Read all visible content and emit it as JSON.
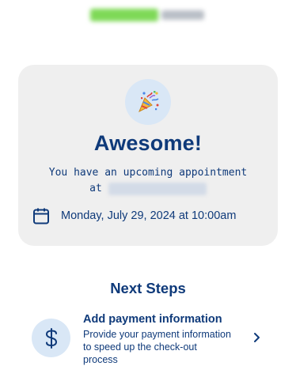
{
  "card": {
    "title": "Awesome!",
    "message_line1": "You have an upcoming appointment",
    "message_line2": "at",
    "appointment_datetime": "Monday, July 29, 2024 at 10:00am",
    "party_icon": "party-popper-icon",
    "calendar_icon": "calendar-icon"
  },
  "next_steps": {
    "title": "Next Steps",
    "items": [
      {
        "title": "Add payment information",
        "description": "Provide your payment information to speed up the check-out process",
        "icon": "dollar-icon",
        "action_icon": "chevron-right-icon"
      }
    ]
  },
  "colors": {
    "primary_text": "#0f3a7a",
    "card_bg": "#efefef",
    "icon_circle_bg": "#d9e7f6"
  }
}
